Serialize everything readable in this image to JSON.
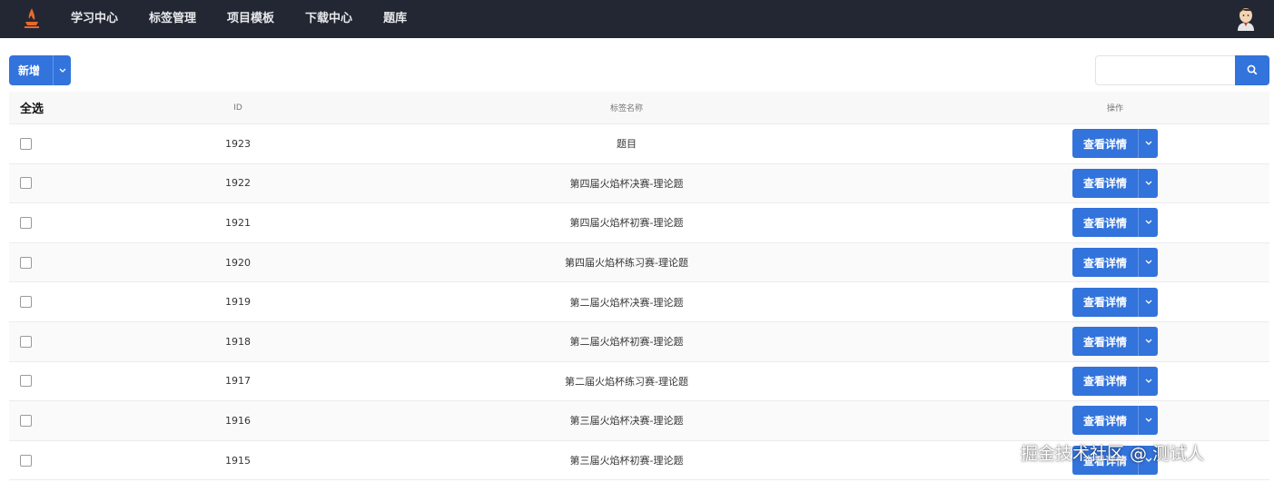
{
  "nav": {
    "logo_icon": "flame-cup-logo-icon",
    "items": [
      "学习中心",
      "标签管理",
      "项目模板",
      "下载中心",
      "题库"
    ],
    "avatar_icon": "user-avatar-icon"
  },
  "toolbar": {
    "add_label": "新增",
    "add_caret_icon": "chevron-down-icon",
    "search_placeholder": "",
    "search_icon": "search-icon"
  },
  "table": {
    "headers": {
      "select_all": "全选",
      "id": "ID",
      "name": "标签名称",
      "action": "操作"
    },
    "rows": [
      {
        "id": "1923",
        "name": "题目",
        "action": "查看详情"
      },
      {
        "id": "1922",
        "name": "第四届火焰杯决赛-理论题",
        "action": "查看详情"
      },
      {
        "id": "1921",
        "name": "第四届火焰杯初赛-理论题",
        "action": "查看详情"
      },
      {
        "id": "1920",
        "name": "第四届火焰杯练习赛-理论题",
        "action": "查看详情"
      },
      {
        "id": "1919",
        "name": "第二届火焰杯决赛-理论题",
        "action": "查看详情"
      },
      {
        "id": "1918",
        "name": "第二届火焰杯初赛-理论题",
        "action": "查看详情"
      },
      {
        "id": "1917",
        "name": "第二届火焰杯练习赛-理论题",
        "action": "查看详情"
      },
      {
        "id": "1916",
        "name": "第三届火焰杯决赛-理论题",
        "action": "查看详情"
      },
      {
        "id": "1915",
        "name": "第三届火焰杯初赛-理论题",
        "action": "查看详情"
      }
    ]
  },
  "watermark": "掘金技术社区 @ 测试人",
  "colors": {
    "navbar": "#222733",
    "primary": "#3273dc"
  }
}
